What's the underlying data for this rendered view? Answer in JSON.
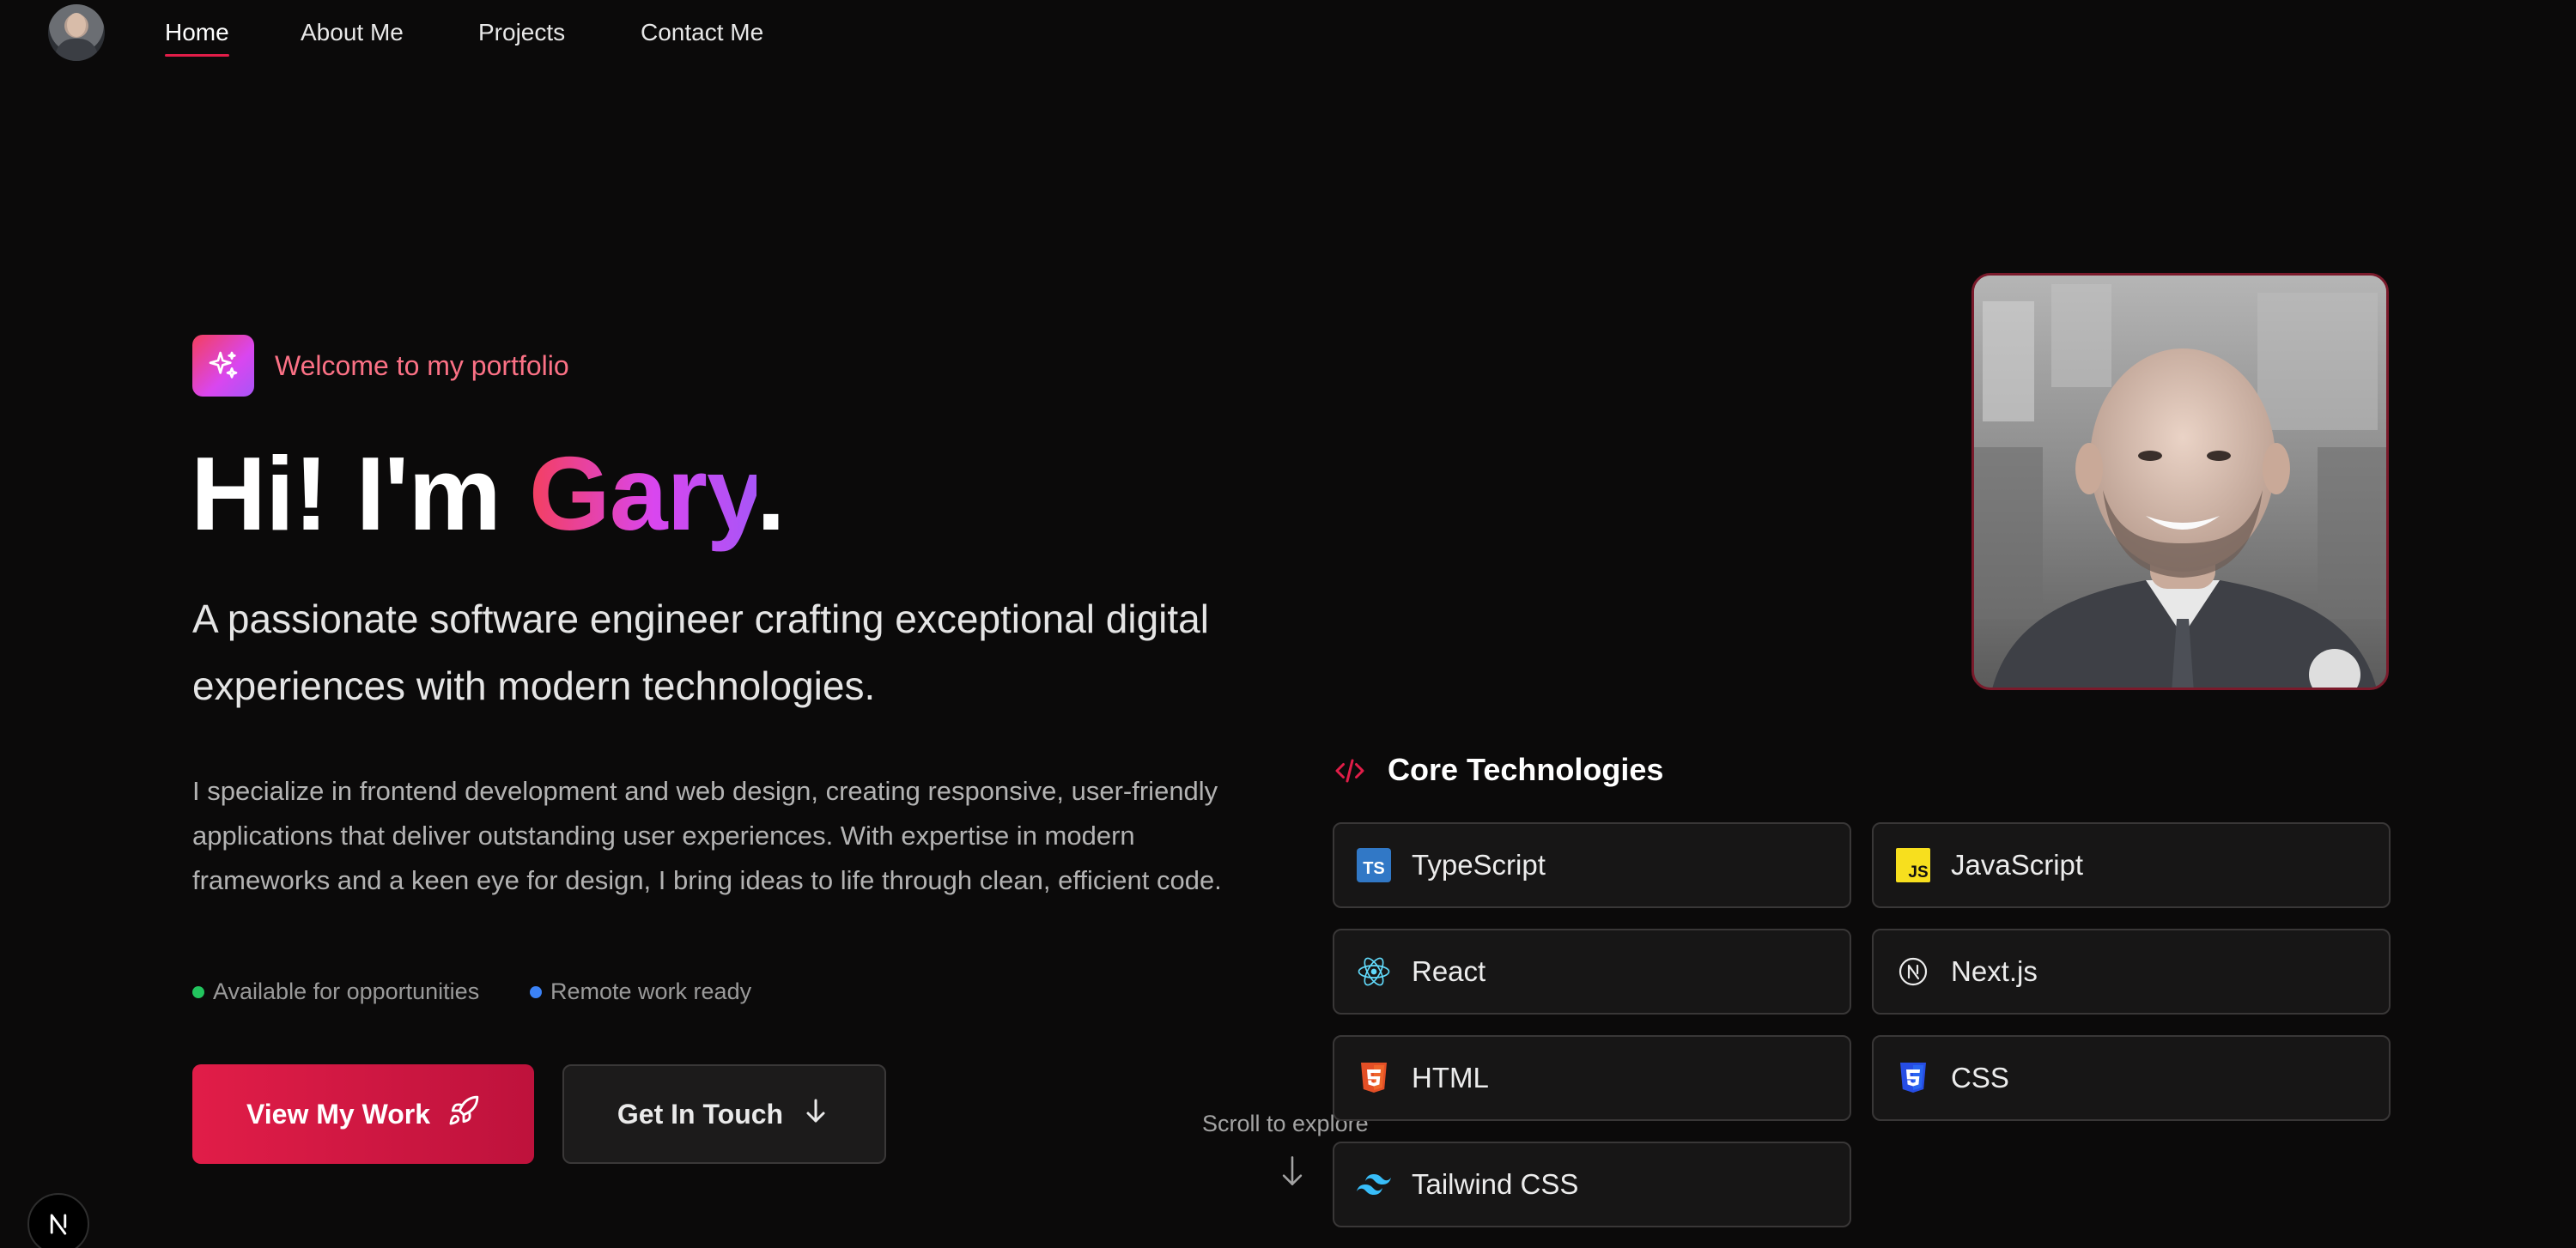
{
  "nav": {
    "items": [
      {
        "label": "Home",
        "active": true
      },
      {
        "label": "About Me"
      },
      {
        "label": "Projects"
      },
      {
        "label": "Contact Me"
      }
    ]
  },
  "hero": {
    "welcome": "Welcome to my portfolio",
    "greeting": "Hi! I'm ",
    "name": "Gary",
    "period": ".",
    "subtitle": "A passionate software engineer crafting exceptional digital experiences with modern technologies.",
    "bio": "I specialize in frontend development and web design, creating responsive, user-friendly applications that deliver outstanding user experiences. With expertise in modern frameworks and a keen eye for design, I bring ideas to life through clean, efficient code.",
    "status": [
      {
        "label": "Available for opportunities",
        "color": "#22c55e"
      },
      {
        "label": "Remote work ready",
        "color": "#3b82f6"
      }
    ],
    "primary_button": "View My Work",
    "secondary_button": "Get In Touch"
  },
  "scroll": {
    "label": "Scroll to explore"
  },
  "tech": {
    "title": "Core Technologies",
    "items": [
      {
        "label": "TypeScript",
        "icon": "typescript-icon"
      },
      {
        "label": "JavaScript",
        "icon": "javascript-icon"
      },
      {
        "label": "React",
        "icon": "react-icon"
      },
      {
        "label": "Next.js",
        "icon": "nextjs-icon"
      },
      {
        "label": "HTML",
        "icon": "html5-icon"
      },
      {
        "label": "CSS",
        "icon": "css3-icon"
      },
      {
        "label": "Tailwind CSS",
        "icon": "tailwind-icon"
      }
    ]
  },
  "colors": {
    "accent": "#e11d48",
    "gradient_start": "#f43f5e",
    "gradient_end": "#a855f7",
    "background": "#0b0a0a"
  }
}
